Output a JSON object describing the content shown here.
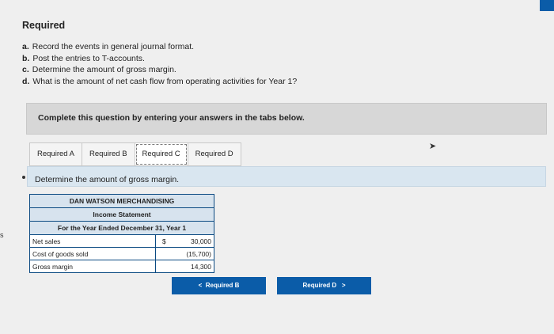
{
  "heading": "Required",
  "questions": [
    {
      "letter": "a.",
      "text": "Record the events in general journal format."
    },
    {
      "letter": "b.",
      "text": "Post the entries to T-accounts."
    },
    {
      "letter": "c.",
      "text": "Determine the amount of gross margin."
    },
    {
      "letter": "d.",
      "text": "What is the amount of net cash flow from operating activities for Year 1?"
    }
  ],
  "instruction": "Complete this question by entering your answers in the tabs below.",
  "tabs": [
    "Required A",
    "Required B",
    "Required C",
    "Required D"
  ],
  "active_tab": "Required C",
  "content_prompt": "Determine the amount of gross margin.",
  "statement": {
    "company": "DAN WATSON MERCHANDISING",
    "title": "Income Statement",
    "period": "For the Year Ended December 31, Year 1",
    "rows": [
      {
        "label": "Net sales",
        "symbol": "$",
        "value": "30,000"
      },
      {
        "label": "Cost of goods sold",
        "symbol": "",
        "value": "(15,700)"
      },
      {
        "label": "Gross margin",
        "symbol": "",
        "value": "14,300"
      }
    ]
  },
  "nav": {
    "prev_label": "Required B",
    "prev_arrow": "<",
    "next_label": "Required D",
    "next_arrow": ">"
  },
  "edge_fragment": "s",
  "colors": {
    "accent": "#0b5ca8",
    "table_border": "#0b4a82",
    "header_bg": "#d7e3ee"
  }
}
